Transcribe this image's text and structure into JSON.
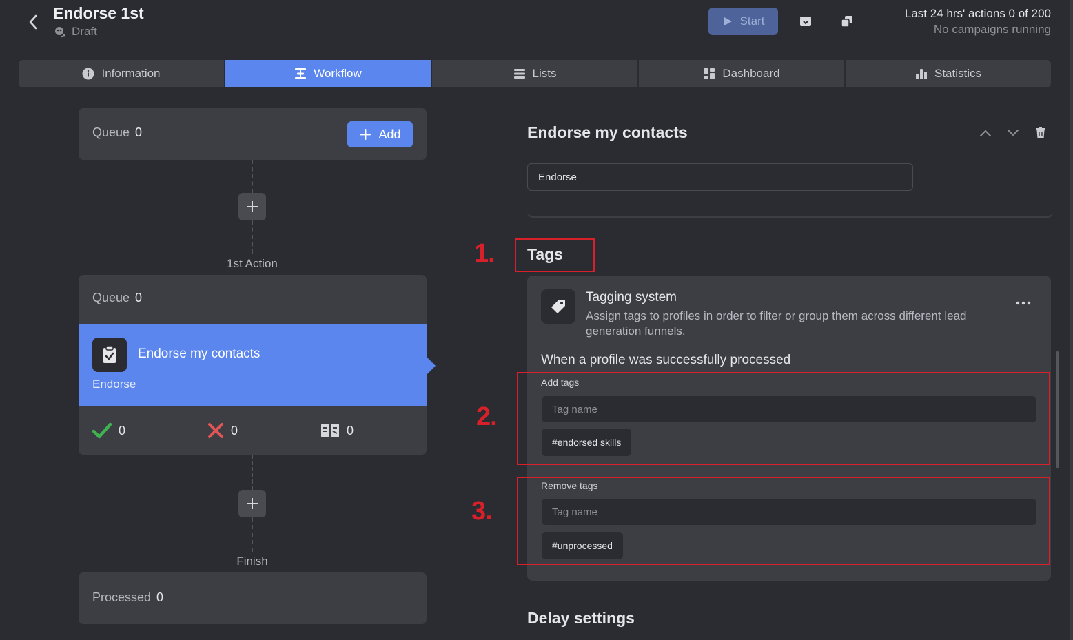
{
  "header": {
    "title": "Endorse 1st",
    "status": "Draft",
    "start_label": "Start",
    "actions_summary": "Last 24 hrs' actions 0 of 200",
    "campaign_status": "No campaigns running"
  },
  "tabs": [
    {
      "label": "Information",
      "icon": "info-icon"
    },
    {
      "label": "Workflow",
      "icon": "workflow-icon",
      "active": true
    },
    {
      "label": "Lists",
      "icon": "list-icon"
    },
    {
      "label": "Dashboard",
      "icon": "dashboard-icon"
    },
    {
      "label": "Statistics",
      "icon": "bar-chart-icon"
    }
  ],
  "workflow": {
    "queue_label": "Queue",
    "queue_count": "0",
    "add_label": "Add",
    "step1_label": "1st Action",
    "action": {
      "queue_label": "Queue",
      "queue_count": "0",
      "title": "Endorse my contacts",
      "subtitle": "Endorse",
      "success_count": "0",
      "failed_count": "0",
      "skipped_count": "0"
    },
    "finish_label": "Finish",
    "processed_label": "Processed",
    "processed_count": "0"
  },
  "panel": {
    "title": "Endorse my contacts",
    "name_value": "Endorse",
    "tags_title": "Tags",
    "tagging_title": "Tagging system",
    "tagging_desc": "Assign tags to profiles in order to filter or group them across different lead generation funnels.",
    "when_label": "When a profile was successfully processed",
    "add_tags_label": "Add tags",
    "add_tags_placeholder": "Tag name",
    "add_tag_chip": "#endorsed skills",
    "remove_tags_label": "Remove tags",
    "remove_tags_placeholder": "Tag name",
    "remove_tag_chip": "#unprocessed",
    "delay_title": "Delay settings"
  },
  "annotations": {
    "n1": "1.",
    "n2": "2.",
    "n3": "3."
  },
  "colors": {
    "accent": "#5b86ee",
    "background": "#2b2c31",
    "card": "#3d3e44",
    "highlight": "#d8202a",
    "success": "#3fb34f",
    "failed": "#e05555"
  }
}
